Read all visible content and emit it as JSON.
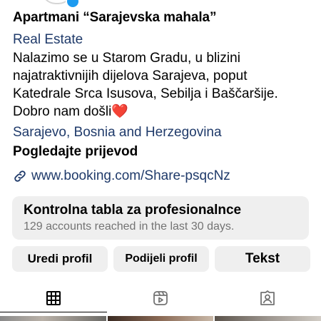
{
  "profile": {
    "name": "Apartmani “Sarajevska mahala”",
    "category": "Real Estate",
    "bio_lines": [
      "Nalazimo se u Starom Gradu, u blizini",
      "najatraktivnijih dijelova Sarajeva, poput",
      "Katedrale Srca Isusova, Sebilja i Baščaršije.",
      "Dobro nam došli"
    ],
    "bio_emoji": "❤️",
    "location": "Sarajevo, Bosnia and Herzegovina",
    "see_translation": "Pogledajte prijevod",
    "link": "www.booking.com/Share-psqcNz"
  },
  "dashboard": {
    "title": "Kontrolna tabla za profesionalnce",
    "subtitle": "129 accounts reached in the last 30 days."
  },
  "buttons": {
    "edit_profile": "Uredi profil",
    "share_profile": "Podijeli profil",
    "text": "Tekst"
  },
  "tabs": [
    {
      "icon": "grid-icon",
      "active": true
    },
    {
      "icon": "reels-icon",
      "active": false
    },
    {
      "icon": "tagged-icon",
      "active": false
    }
  ],
  "colors": {
    "link_blue": "#1f3a6a",
    "button_bg": "#efefef",
    "subtitle_gray": "#737373"
  }
}
